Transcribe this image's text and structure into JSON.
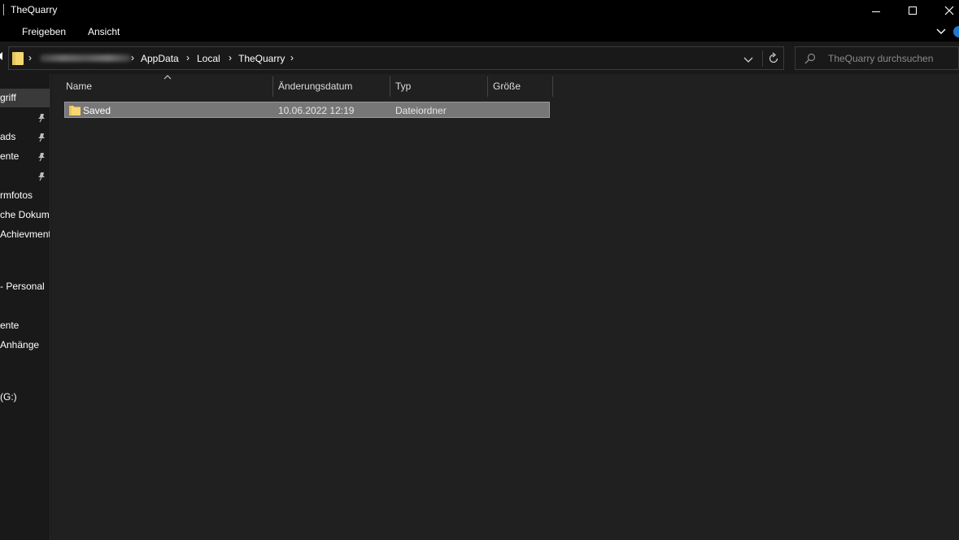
{
  "window": {
    "title": "TheQuarry"
  },
  "ribbon": {
    "tabs": [
      "Freigeben",
      "Ansicht"
    ]
  },
  "address": {
    "crumbs": [
      "AppData",
      "Local",
      "TheQuarry"
    ],
    "separator": "›"
  },
  "search": {
    "placeholder": "TheQuarry durchsuchen"
  },
  "nav": {
    "items": [
      {
        "label": "griff",
        "pinned": false
      },
      {
        "label": "",
        "pinned": true
      },
      {
        "label": "ads",
        "pinned": true
      },
      {
        "label": "ente",
        "pinned": true
      },
      {
        "label": "",
        "pinned": true
      },
      {
        "label": "rmfotos",
        "pinned": false
      },
      {
        "label": "che Dokum",
        "pinned": false
      },
      {
        "label": "Achievment",
        "pinned": false
      },
      {
        "label": "- Personal",
        "pinned": false
      },
      {
        "label": "ente",
        "pinned": false
      },
      {
        "label": "Anhänge",
        "pinned": false
      },
      {
        "label": "(G:)",
        "pinned": false
      }
    ]
  },
  "list": {
    "columns": [
      "Name",
      "Änderungsdatum",
      "Typ",
      "Größe"
    ],
    "rows": [
      {
        "name": "Saved",
        "date": "10.06.2022 12:19",
        "type": "Dateiordner",
        "size": ""
      }
    ]
  },
  "colors": {
    "titlebar": "#000000",
    "background": "#191919",
    "content": "#202020",
    "selection": "#777777",
    "folder": "#f5d66f",
    "accent": "#1e78d2"
  }
}
